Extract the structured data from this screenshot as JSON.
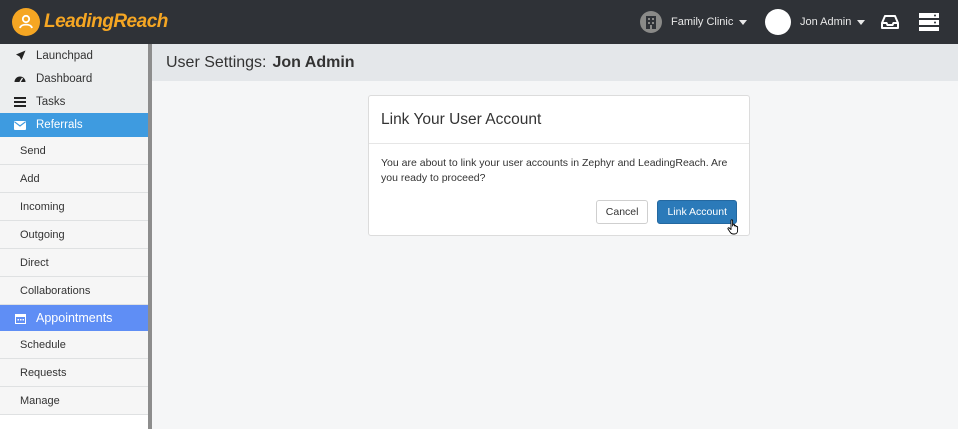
{
  "brand": {
    "logo_text": "LeadingReach",
    "logo_color": "#f5a623"
  },
  "header": {
    "clinic_label": "Family Clinic",
    "user_label": "Jon Admin"
  },
  "sidebar": {
    "items": [
      {
        "label": "Launchpad",
        "icon": "rocket-icon"
      },
      {
        "label": "Dashboard",
        "icon": "dashboard-icon"
      },
      {
        "label": "Tasks",
        "icon": "tasks-icon"
      }
    ],
    "referrals": {
      "label": "Referrals",
      "icon": "envelope-icon",
      "color": "#3e9be0",
      "children": [
        "Send",
        "Add",
        "Incoming",
        "Outgoing",
        "Direct",
        "Collaborations"
      ]
    },
    "appointments": {
      "label": "Appointments",
      "icon": "calendar-icon",
      "color": "#5f8ef5",
      "children": [
        "Schedule",
        "Requests",
        "Manage"
      ]
    }
  },
  "page": {
    "title_prefix": "User Settings:",
    "title_name": "Jon Admin"
  },
  "dialog": {
    "title": "Link Your User Account",
    "message": "You are about to link your user accounts in Zephyr and LeadingReach. Are you ready to proceed?",
    "cancel_label": "Cancel",
    "confirm_label": "Link Account",
    "confirm_color": "#2b7ab9"
  }
}
